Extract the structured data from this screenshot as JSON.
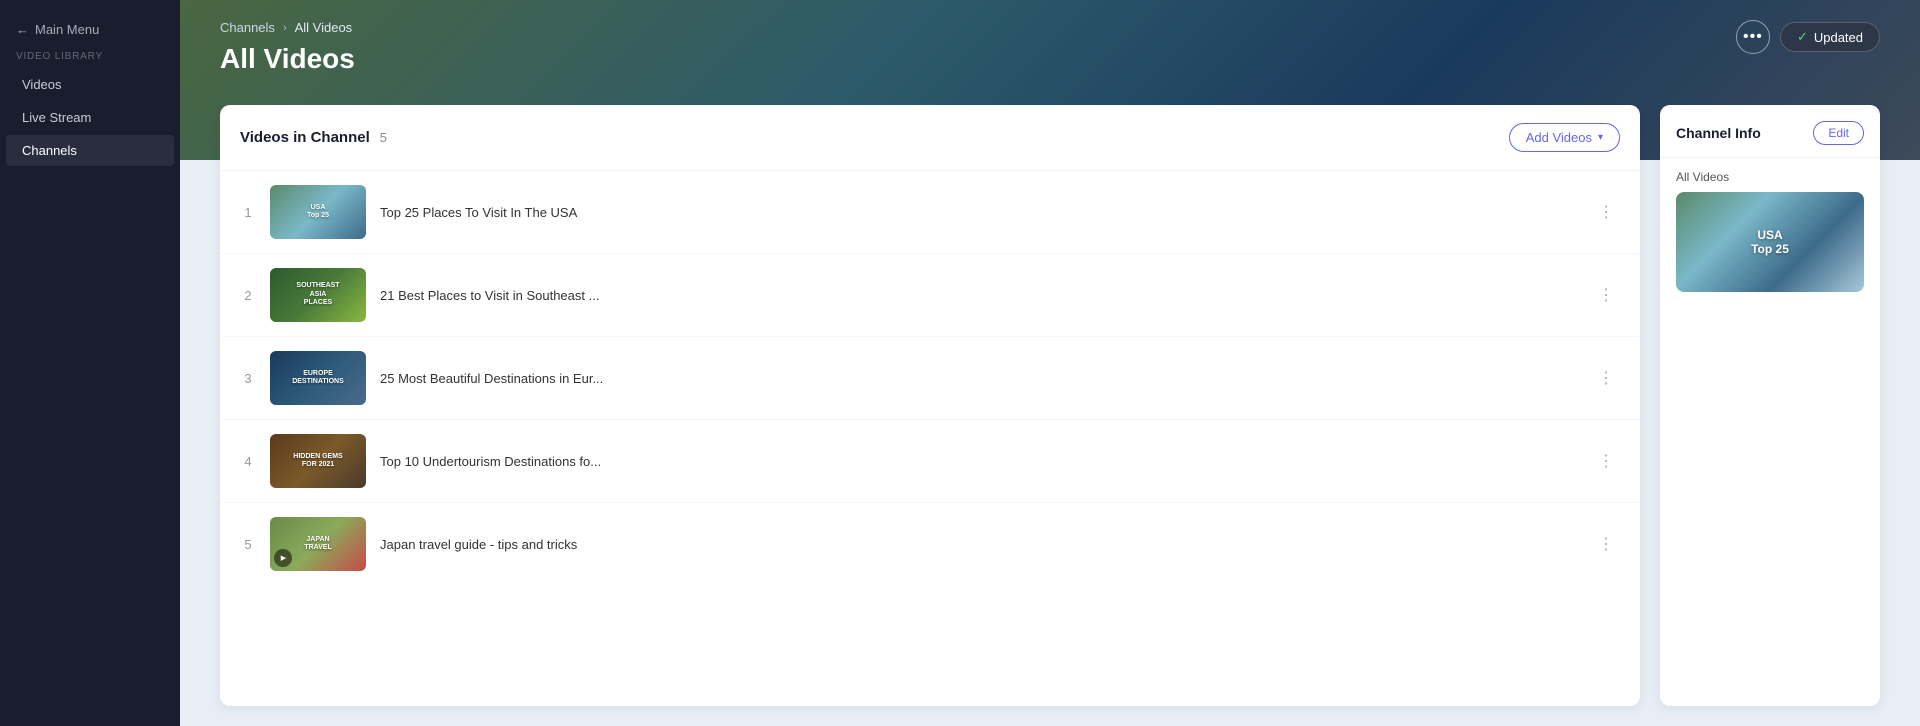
{
  "sidebar": {
    "main_menu_label": "Main Menu",
    "section_label": "Video Library",
    "items": [
      {
        "id": "videos",
        "label": "Videos",
        "active": false
      },
      {
        "id": "live-stream",
        "label": "Live Stream",
        "active": false
      },
      {
        "id": "channels",
        "label": "Channels",
        "active": true
      }
    ]
  },
  "header": {
    "breadcrumb": {
      "channels": "Channels",
      "separator": "›",
      "current": "All Videos"
    },
    "title": "All Videos",
    "more_button_label": "•••",
    "updated_button": {
      "check": "✓",
      "label": "Updated"
    }
  },
  "videos_panel": {
    "title": "Videos in Channel",
    "count": "5",
    "add_videos_label": "Add Videos",
    "videos": [
      {
        "number": "1",
        "title": "Top 25 Places To Visit In The USA",
        "thumb_class": "thumb-usa",
        "thumb_text": "USA\nTop 25",
        "has_play": false
      },
      {
        "number": "2",
        "title": "21 Best Places to Visit in Southeast ...",
        "thumb_class": "thumb-sea",
        "thumb_text": "SOUTHEAST\nASIA\nPLACES",
        "has_play": false
      },
      {
        "number": "3",
        "title": "25 Most Beautiful Destinations in Eur...",
        "thumb_class": "thumb-europe",
        "thumb_text": "EUROPE\nDESTINATIONS",
        "has_play": false
      },
      {
        "number": "4",
        "title": "Top 10 Undertourism Destinations fo...",
        "thumb_class": "thumb-hidden",
        "thumb_text": "HIDDEN GEMS\nFOR 2021",
        "has_play": false
      },
      {
        "number": "5",
        "title": "Japan travel guide - tips and tricks",
        "thumb_class": "thumb-japan",
        "thumb_text": "JAPAN\nTRAVEL",
        "has_play": true
      }
    ]
  },
  "channel_info": {
    "title": "Channel Info",
    "edit_label": "Edit",
    "section_label": "All Videos",
    "thumb_text": "USA\nTop 25"
  }
}
